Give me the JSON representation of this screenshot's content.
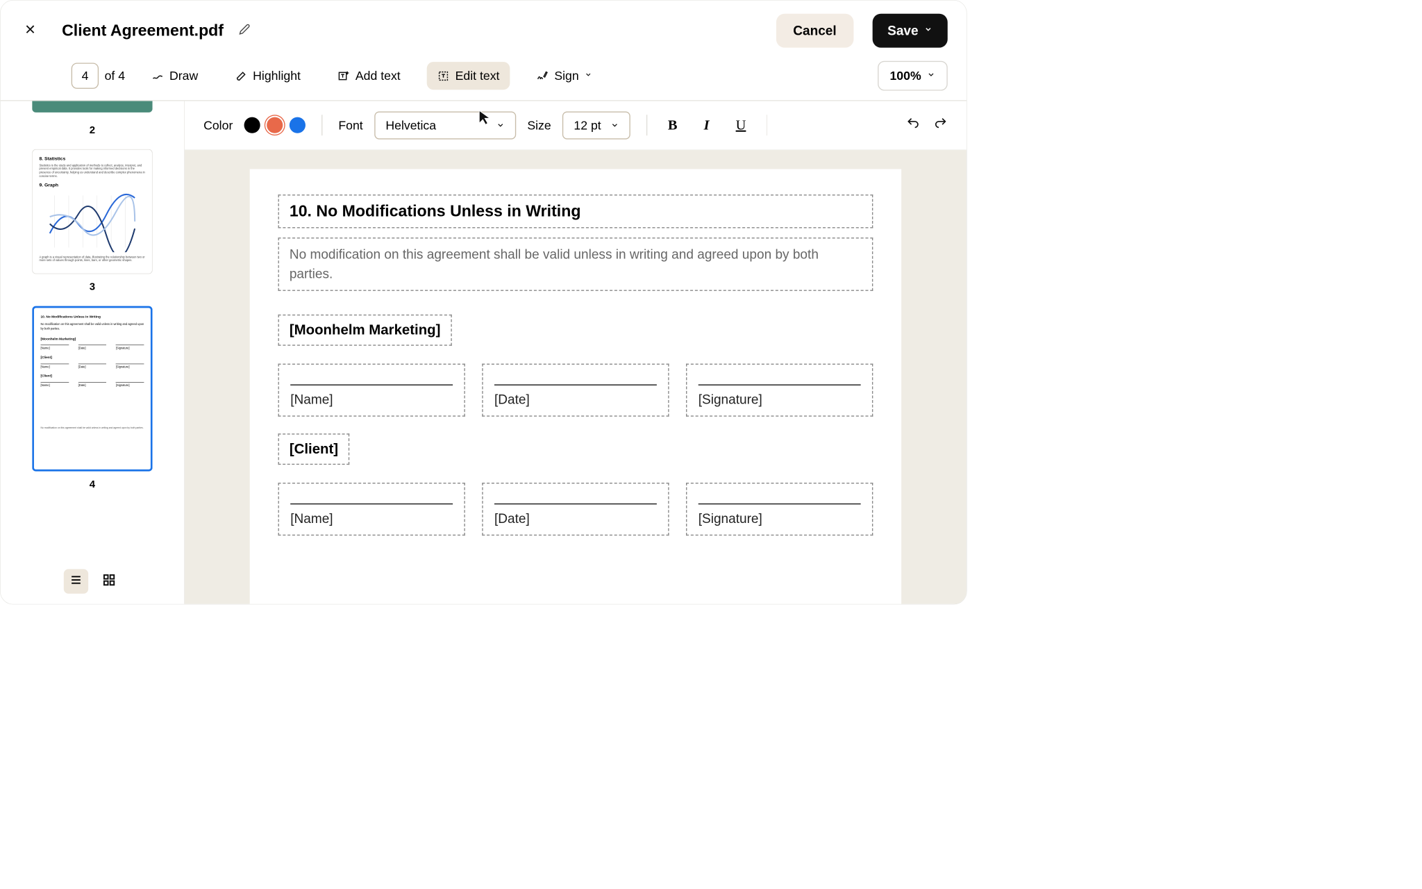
{
  "header": {
    "title": "Client Agreement.pdf",
    "cancel_label": "Cancel",
    "save_label": "Save"
  },
  "toolbar": {
    "current_page": "4",
    "page_of": "of 4",
    "draw": "Draw",
    "highlight": "Highlight",
    "add_text": "Add text",
    "edit_text": "Edit text",
    "sign": "Sign",
    "zoom": "100%"
  },
  "format": {
    "color_label": "Color",
    "colors": {
      "black": "#000000",
      "orange": "#e8694a",
      "blue": "#1a73e8"
    },
    "selected_color": "orange",
    "font_label": "Font",
    "font_value": "Helvetica",
    "size_label": "Size",
    "size_value": "12 pt"
  },
  "thumbs": {
    "p2_num": "2",
    "p3_num": "3",
    "p4_num": "4",
    "p3": {
      "h1": "8. Statistics",
      "body1": "Statistics is the study and application of methods to collect, analyze, interpret, and present empirical data. It provides tools for making informed decisions in the presence of uncertainty, helping us understand and describe complex phenomena in concise terms.",
      "h2": "9. Graph",
      "body2": "A graph is a visual representation of data, illustrating the relationship between two or more sets of values through points, lines, bars, or other geometric shapes."
    },
    "p4": {
      "h": "10. No Modifications Unless in Writing",
      "body": "No modification on this agreement shall be valid unless in writing and agreed upon by both parties.",
      "party1": "[Moonhelm Marketing]",
      "party2": "[Client]",
      "name": "[Name]",
      "date": "[Date]",
      "sig": "[Signature]",
      "foot": "No modification on this agreement shall be valid unless in writing and agreed upon by both parties."
    }
  },
  "document": {
    "heading": "10. No Modifications Unless in Writing",
    "body": "No modification on this agreement shall be valid unless in writing and agreed upon by both parties.",
    "party1": "[Moonhelm Marketing]",
    "party2": "[Client]",
    "fields": {
      "name": "[Name]",
      "date": "[Date]",
      "signature": "[Signature]"
    }
  }
}
